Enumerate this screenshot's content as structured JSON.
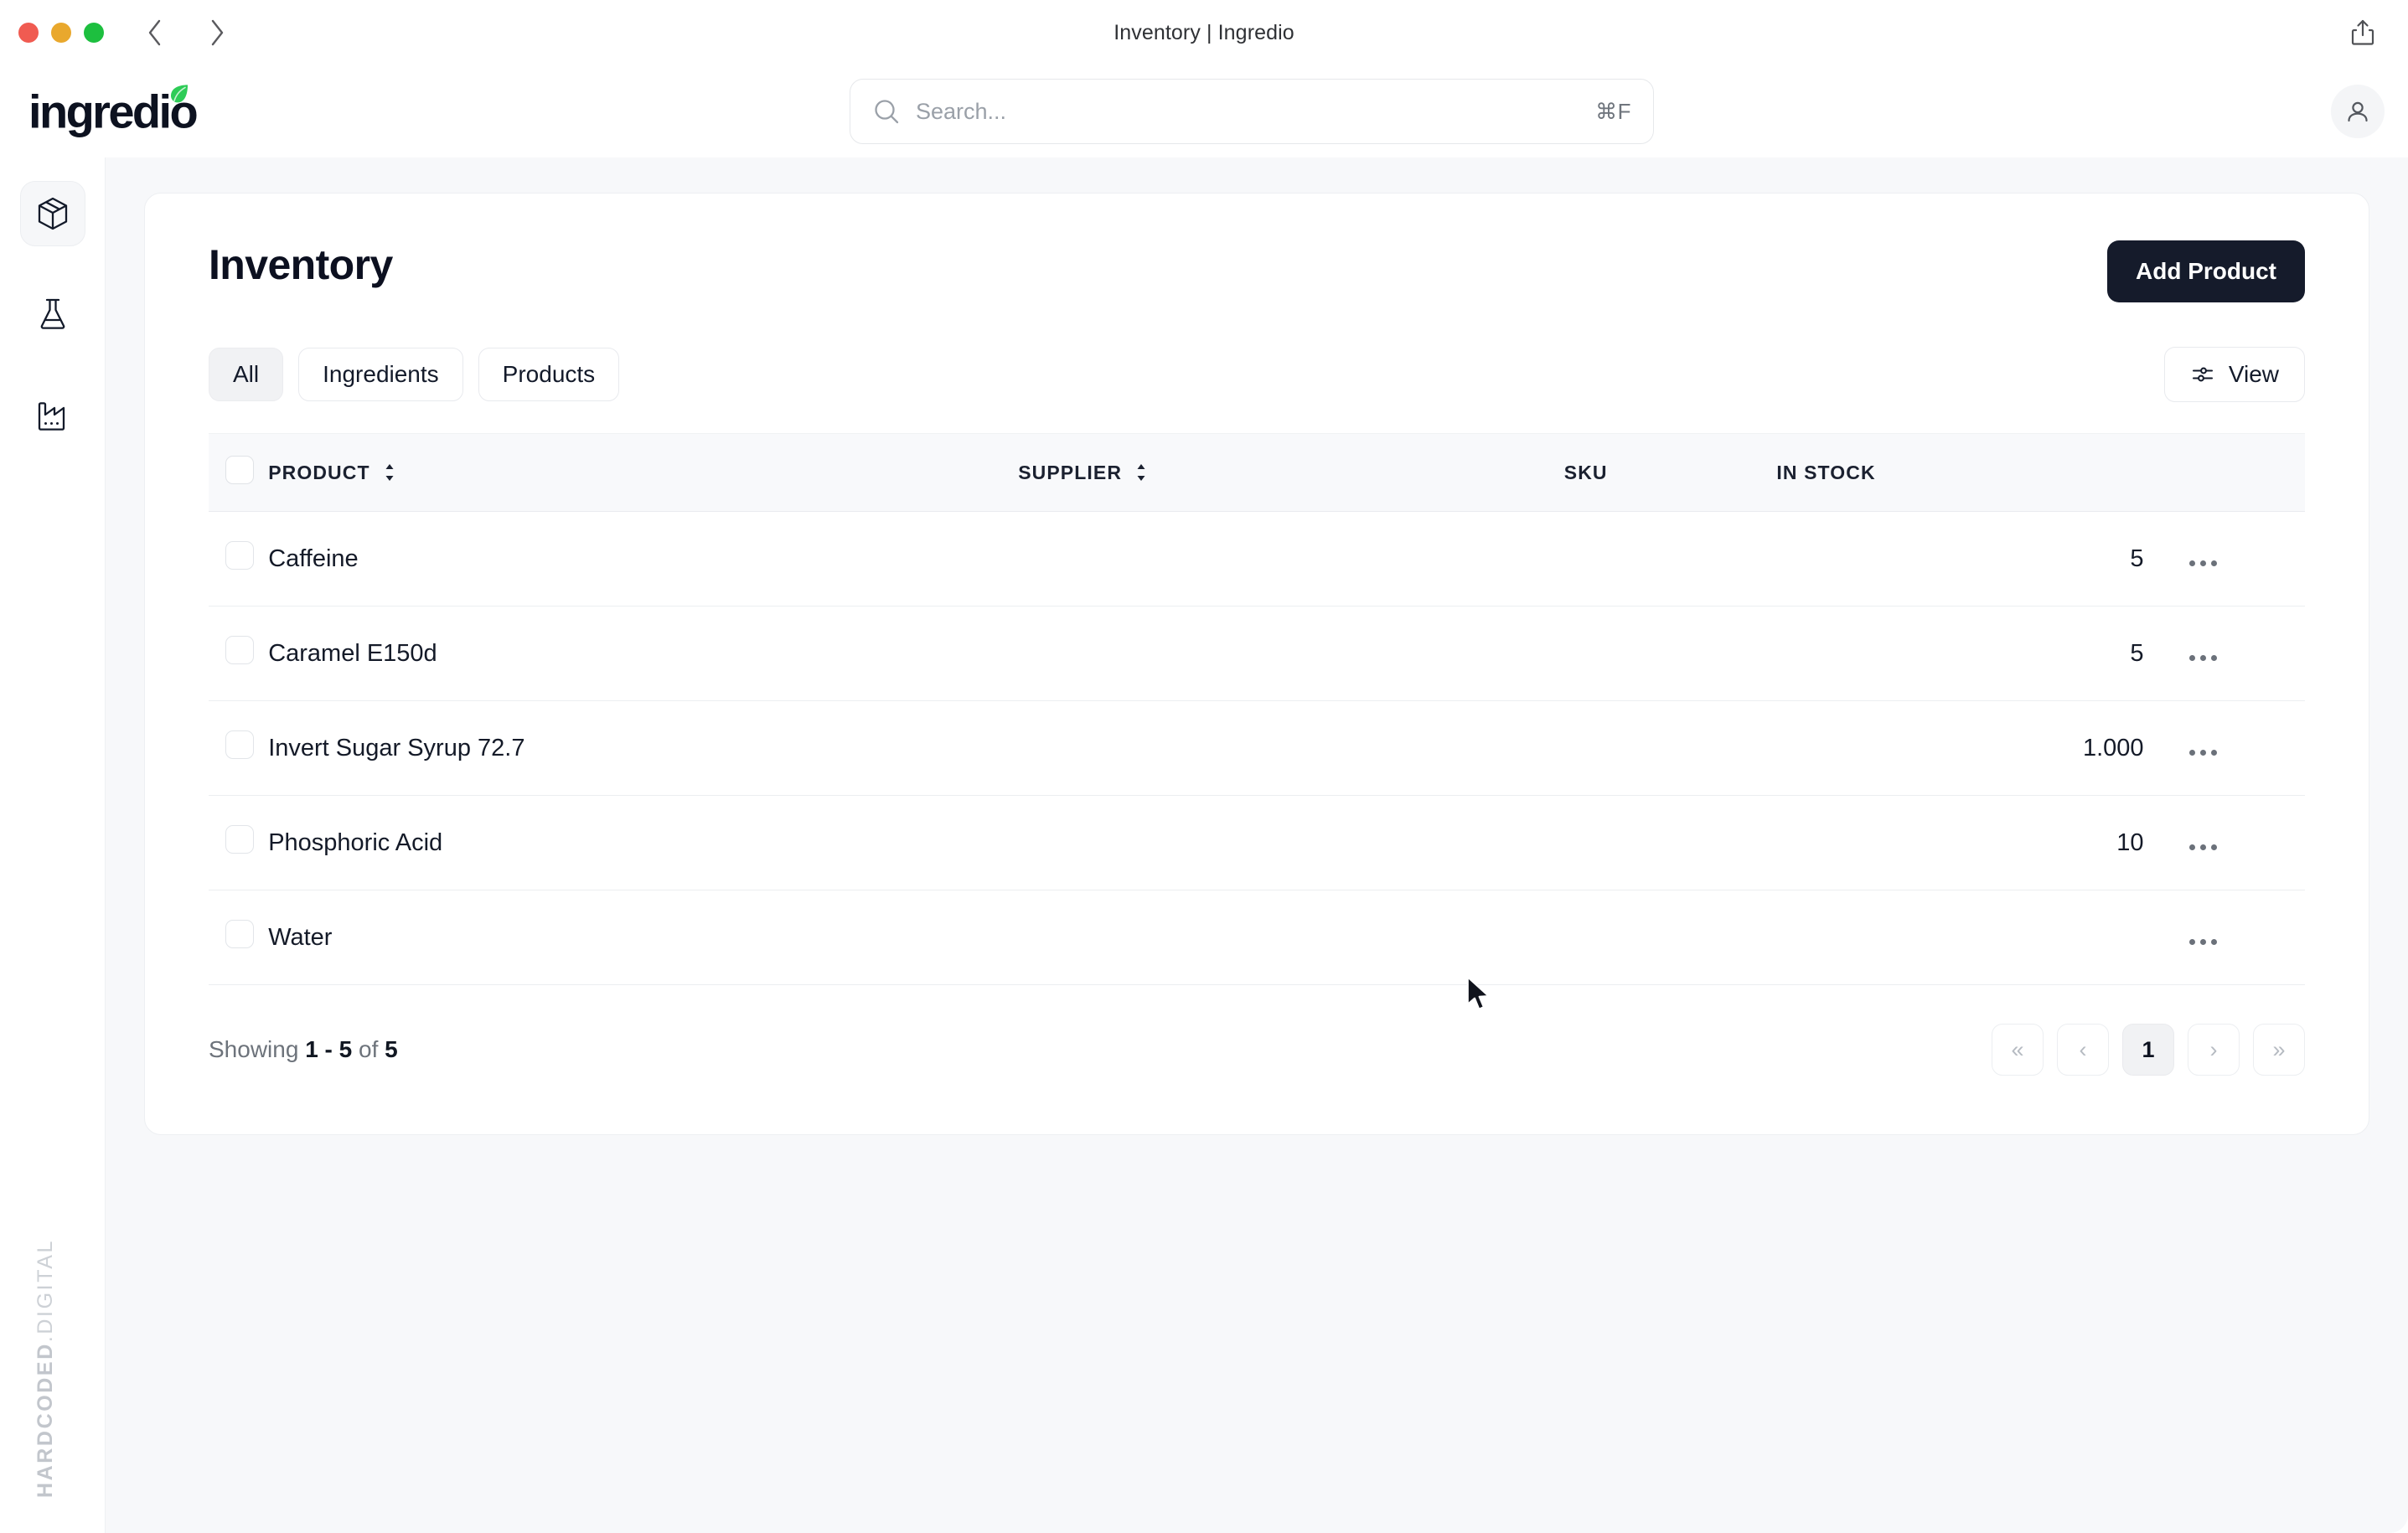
{
  "window": {
    "title": "Inventory | Ingredio",
    "traffic_lights": [
      "close",
      "minimize",
      "zoom"
    ],
    "share_icon": "share-icon"
  },
  "app": {
    "brand": "ingredio",
    "search": {
      "placeholder": "Search...",
      "value": "",
      "shortcut": "⌘F"
    },
    "avatar": "user-avatar"
  },
  "sidebar": {
    "items": [
      {
        "name": "inventory",
        "icon": "package-icon",
        "active": true
      },
      {
        "name": "recipes",
        "icon": "flask-icon",
        "active": false
      },
      {
        "name": "production",
        "icon": "factory-icon",
        "active": false
      }
    ],
    "watermark_bold": "HARDCODED",
    "watermark_light": ".DIGITAL"
  },
  "page": {
    "title": "Inventory",
    "add_button": "Add Product",
    "filters": [
      {
        "label": "All",
        "active": true
      },
      {
        "label": "Ingredients",
        "active": false
      },
      {
        "label": "Products",
        "active": false
      }
    ],
    "view_button": "View"
  },
  "table": {
    "columns": [
      {
        "key": "product",
        "label": "PRODUCT",
        "sortable": true
      },
      {
        "key": "supplier",
        "label": "SUPPLIER",
        "sortable": true
      },
      {
        "key": "sku",
        "label": "SKU",
        "sortable": false
      },
      {
        "key": "in_stock",
        "label": "IN STOCK",
        "sortable": false
      }
    ],
    "rows": [
      {
        "product": "Caffeine",
        "supplier": "",
        "sku": "",
        "in_stock": "5"
      },
      {
        "product": "Caramel E150d",
        "supplier": "",
        "sku": "",
        "in_stock": "5"
      },
      {
        "product": "Invert Sugar Syrup 72.7",
        "supplier": "",
        "sku": "",
        "in_stock": "1.000"
      },
      {
        "product": "Phosphoric Acid",
        "supplier": "",
        "sku": "",
        "in_stock": "10"
      },
      {
        "product": "Water",
        "supplier": "",
        "sku": "",
        "in_stock": ""
      }
    ],
    "row_menu_icon": "ellipsis-icon"
  },
  "footer": {
    "showing_prefix": "Showing",
    "showing_range": "1 - 5",
    "showing_of": "of",
    "showing_total": "5",
    "pagination": [
      {
        "label": "«",
        "name": "first-page",
        "active": false
      },
      {
        "label": "‹",
        "name": "prev-page",
        "active": false
      },
      {
        "label": "1",
        "name": "page-1",
        "active": true
      },
      {
        "label": "›",
        "name": "next-page",
        "active": false
      },
      {
        "label": "»",
        "name": "last-page",
        "active": false
      }
    ]
  },
  "colors": {
    "accent_dark": "#151b2b",
    "leaf_green": "#2ecc57",
    "page_bg": "#f7f8fa",
    "card_bg": "#ffffff",
    "border": "#eceef1"
  }
}
